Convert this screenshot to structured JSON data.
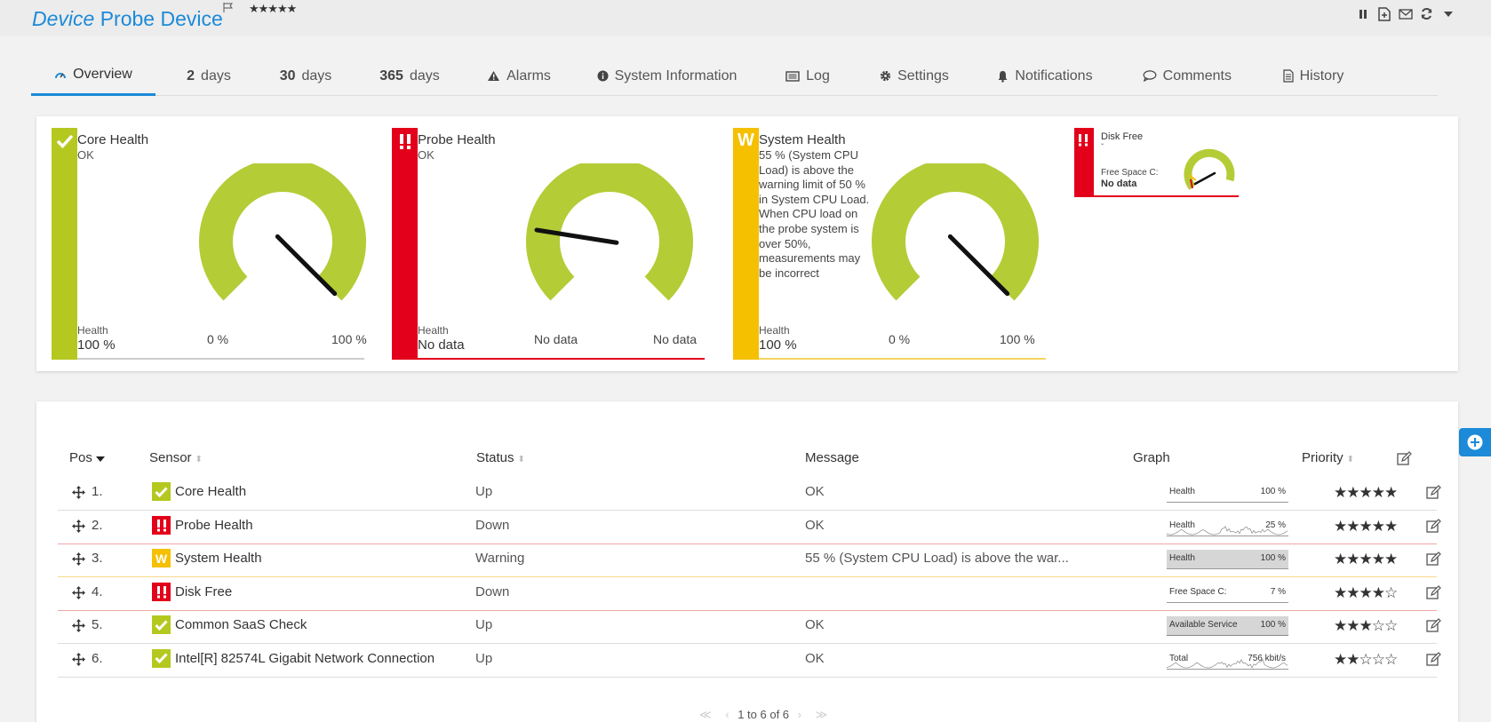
{
  "header": {
    "title_italic": "Device",
    "title_rest": "Probe Device",
    "stars": "★★★★★",
    "actions": [
      "pause-icon",
      "export-icon",
      "mail-icon",
      "refresh-icon",
      "dropdown-icon"
    ]
  },
  "tabs": [
    {
      "label": "Overview",
      "icon": "gauge-icon"
    },
    {
      "num": "2",
      "label": "days"
    },
    {
      "num": "30",
      "label": "days"
    },
    {
      "num": "365",
      "label": "days"
    },
    {
      "label": "Alarms",
      "icon": "warning-icon"
    },
    {
      "label": "System Information",
      "icon": "info-icon"
    },
    {
      "label": "Log",
      "icon": "log-icon"
    },
    {
      "label": "Settings",
      "icon": "gear-icon"
    },
    {
      "label": "Notifications",
      "icon": "bell-icon"
    },
    {
      "label": "Comments",
      "icon": "comment-icon"
    },
    {
      "label": "History",
      "icon": "history-icon"
    }
  ],
  "gauges": [
    {
      "name": "Core Health",
      "status": "ok",
      "status_text": "OK",
      "health_label": "Health",
      "health_value": "100 %",
      "min": "0 %",
      "max": "100 %",
      "needle": 1.0
    },
    {
      "name": "Probe Health",
      "status": "down",
      "status_text": "OK",
      "health_label": "Health",
      "health_value": "No data",
      "min": "No data",
      "max": "No data",
      "needle": 0.2
    },
    {
      "name": "System Health",
      "status": "warning",
      "message": "55 % (System CPU Load) is above the warning limit of 50 % in System CPU Load. When CPU load on the probe system is over 50%, measurements may be incorrect",
      "health_label": "Health",
      "health_value": "100 %",
      "min": "0 %",
      "max": "100 %",
      "needle": 1.0
    },
    {
      "name": "Disk Free",
      "status": "down",
      "chevron": "ˇ",
      "channel": "Free Space C:",
      "value": "No data"
    }
  ],
  "table": {
    "headers": {
      "pos": "Pos",
      "sensor": "Sensor",
      "status": "Status",
      "message": "Message",
      "graph": "Graph",
      "priority": "Priority"
    },
    "rows": [
      {
        "pos": "1.",
        "sensor": "Core Health",
        "state": "ok",
        "status": "Up",
        "message": "OK",
        "graph_label": "Health",
        "graph_value": "100 %",
        "stars": "★★★★★"
      },
      {
        "pos": "2.",
        "sensor": "Probe Health",
        "state": "down",
        "status": "Down",
        "message": "OK",
        "graph_label": "Health",
        "graph_value": "25 %",
        "stars": "★★★★★"
      },
      {
        "pos": "3.",
        "sensor": "System Health",
        "state": "warning",
        "status": "Warning",
        "message": "55 % (System CPU Load) is above the war...",
        "graph_label": "Health",
        "graph_value": "100 %",
        "stars": "★★★★★"
      },
      {
        "pos": "4.",
        "sensor": "Disk Free",
        "state": "down",
        "status": "Down",
        "message": "",
        "graph_label": "Free Space C:",
        "graph_value": "7 %",
        "stars": "★★★★☆"
      },
      {
        "pos": "5.",
        "sensor": "Common SaaS Check",
        "state": "ok",
        "status": "Up",
        "message": "OK",
        "graph_label": "Available Service",
        "graph_value": "100 %",
        "stars": "★★★☆☆"
      },
      {
        "pos": "6.",
        "sensor": "Intel[R] 82574L Gigabit Network Connection",
        "state": "ok",
        "status": "Up",
        "message": "OK",
        "graph_label": "Total",
        "graph_value": "756 kbit/s",
        "stars": "★★☆☆☆"
      }
    ],
    "pager": {
      "first": "≪",
      "prev": "‹",
      "text": "1 to 6 of 6",
      "next": "›",
      "last": "≫"
    }
  },
  "colors": {
    "ok": "#b5c820",
    "down": "#e2001a",
    "warning": "#f5c000",
    "accent": "#1c8ad8",
    "gauge": "#b4cc36"
  }
}
